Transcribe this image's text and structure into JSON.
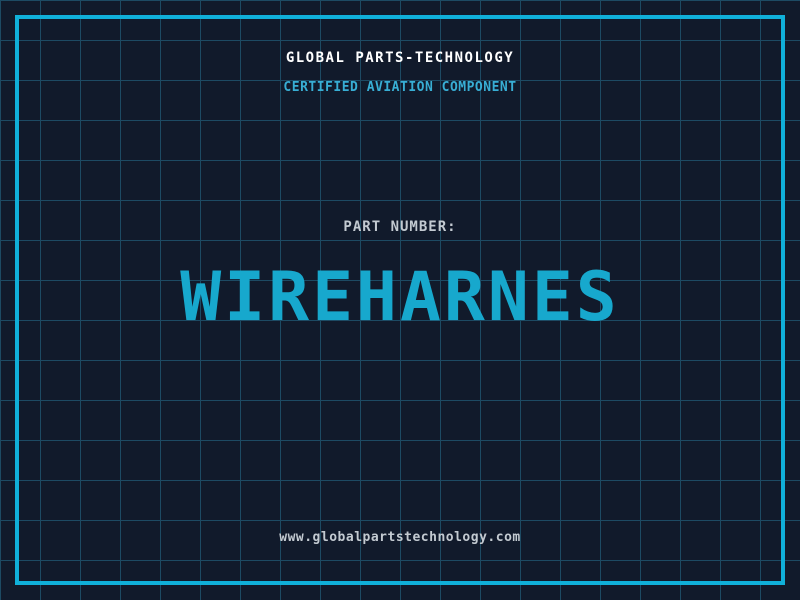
{
  "header": {
    "title": "GLOBAL PARTS-TECHNOLOGY",
    "subtitle": "CERTIFIED AVIATION COMPONENT"
  },
  "part": {
    "label": "PART NUMBER:",
    "value": "WIREHARNES"
  },
  "footer": {
    "website": "www.globalpartstechnology.com"
  },
  "colors": {
    "background": "#111a2b",
    "grid_line": "#1d4a63",
    "frame": "#10b0da",
    "title": "#ffffff",
    "subtitle": "#38aed4",
    "label": "#c3cad1",
    "part_number": "#17a8cd",
    "website": "#c3cad1"
  }
}
